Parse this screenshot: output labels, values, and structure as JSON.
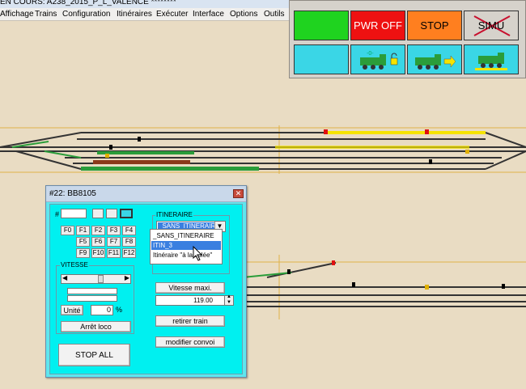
{
  "window": {
    "title": "EN COURS: A238_2015_P_L_VALENCE ********"
  },
  "menu": [
    "Affichage",
    "Trains",
    "Configuration",
    "Itinéraires",
    "Exécuter",
    "Interface",
    "Options",
    "Outils"
  ],
  "control_panel": {
    "pwr_off_label": "PWR OFF",
    "stop_label": "STOP",
    "simu_label": "SIMU",
    "colors": {
      "green": "#1fd31f",
      "red": "#ee1111",
      "orange": "#ff7f1f",
      "cyan": "#3ad6e6",
      "grey": "#d6d2cb"
    }
  },
  "loco_window": {
    "title": "#22: BB8105",
    "hash_label": "#",
    "address_value": "",
    "functions": [
      "F0",
      "F1",
      "F2",
      "F3",
      "F4",
      "F5",
      "F6",
      "F7",
      "F8",
      "F9",
      "F10",
      "F11",
      "F12"
    ],
    "vitesse": {
      "group_label": "VITESSE",
      "unit_button": "Unité",
      "value": "0",
      "unit_symbol": "%"
    },
    "arret_loco": "Arrêt loco",
    "stop_all": "STOP ALL",
    "itineraire": {
      "group_label": "ITINERAIRE",
      "selected": "_SANS_ITINERAIRE",
      "options": [
        "_SANS_ITINERAIRE",
        "ITIN_3",
        "Itinéraire \"à la volée\""
      ],
      "highlighted_option": "ITIN_3"
    },
    "vitesse_maxi_label": "Vitesse maxi.",
    "vitesse_maxi_value": "119.00",
    "retirer_train": "retirer train",
    "modifier_convoi": "modifier convoi"
  }
}
